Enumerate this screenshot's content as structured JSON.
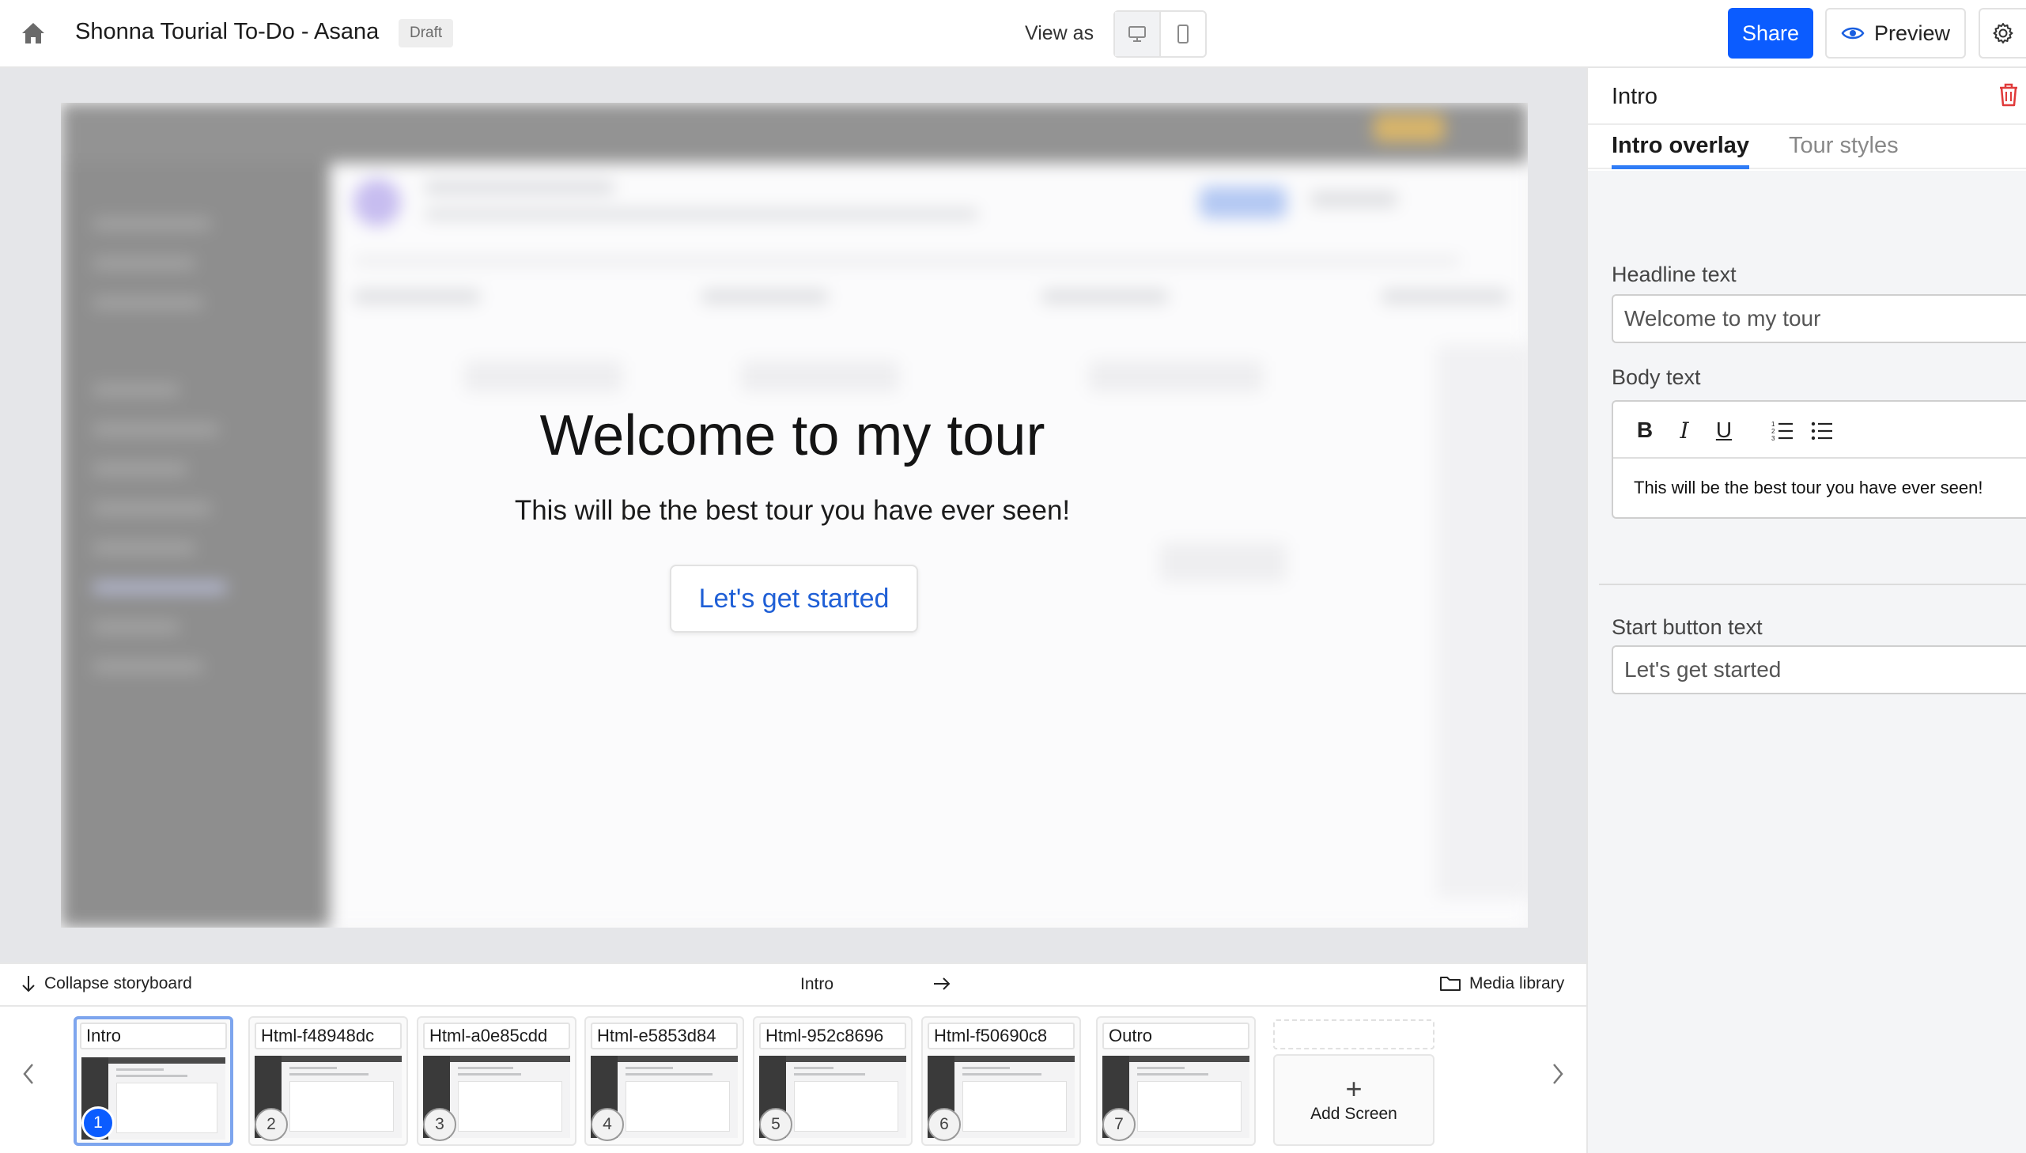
{
  "topbar": {
    "title": "Shonna Tourial To-Do - Asana",
    "status_badge": "Draft",
    "view_as_label": "View as",
    "share_label": "Share",
    "preview_label": "Preview"
  },
  "overlay": {
    "headline": "Welcome to my tour",
    "body": "This will be the best tour you have ever seen!",
    "button": "Let's get started"
  },
  "storyboard": {
    "collapse_label": "Collapse storyboard",
    "current_screen": "Intro",
    "media_label": "Media library",
    "add_label": "Add Screen",
    "screens": [
      {
        "label": "Intro",
        "number": "1"
      },
      {
        "label": "Html-f48948dc",
        "number": "2"
      },
      {
        "label": "Html-a0e85cdd",
        "number": "3"
      },
      {
        "label": "Html-e5853d84",
        "number": "4"
      },
      {
        "label": "Html-952c8696",
        "number": "5"
      },
      {
        "label": "Html-f50690c8",
        "number": "6"
      },
      {
        "label": "Outro",
        "number": "7"
      }
    ]
  },
  "panel": {
    "title": "Intro",
    "tabs": [
      "Intro overlay",
      "Tour styles"
    ],
    "headline_label": "Headline text",
    "headline_value": "Welcome to my tour",
    "body_label": "Body text",
    "body_value": "This will be the best tour you have ever seen!",
    "start_label": "Start button text",
    "start_value": "Let's get started"
  },
  "colors": {
    "accent": "#0b5cff",
    "tab_underline": "#2f7cf6",
    "delete": "#e03a3a"
  }
}
